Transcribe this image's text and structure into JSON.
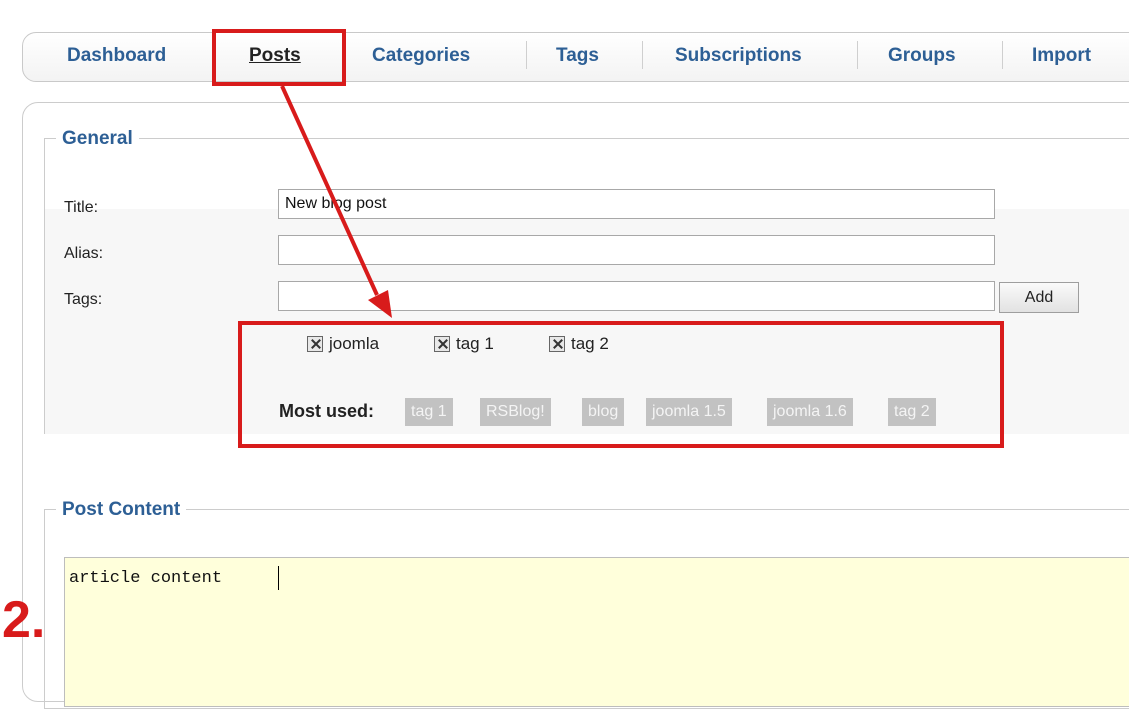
{
  "tabs": [
    {
      "label": "Dashboard"
    },
    {
      "label": "Posts",
      "active": true
    },
    {
      "label": "Categories"
    },
    {
      "label": "Tags"
    },
    {
      "label": "Subscriptions"
    },
    {
      "label": "Groups"
    },
    {
      "label": "Import"
    }
  ],
  "general": {
    "legend": "General",
    "title_label": "Title:",
    "title_value": "New blog post",
    "alias_label": "Alias:",
    "alias_value": "",
    "tags_label": "Tags:",
    "tags_value": "",
    "add_button": "Add",
    "selected_tags": [
      "joomla",
      "tag 1",
      "tag 2"
    ],
    "most_used_label": "Most used:",
    "most_used_tags": [
      "tag 1",
      "RSBlog!",
      "blog",
      "joomla 1.5",
      "joomla 1.6",
      "tag 2"
    ]
  },
  "post_content": {
    "legend": "Post Content",
    "text": "article content"
  },
  "annotation": {
    "step_number": "2.",
    "color": "#d81b1b"
  }
}
